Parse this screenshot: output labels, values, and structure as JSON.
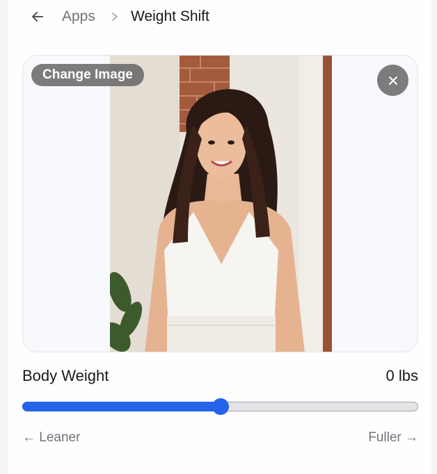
{
  "breadcrumb": {
    "back_icon": "arrow-left-icon",
    "parent": "Apps",
    "separator_icon": "chevron-right-icon",
    "current": "Weight Shift"
  },
  "image_panel": {
    "change_image_label": "Change Image",
    "close_icon": "close-icon",
    "photo_icon": "portrait-photo"
  },
  "weight": {
    "label": "Body Weight",
    "value_text": "0 lbs",
    "slider_value": 0,
    "slider_fraction": 0.5,
    "left_hint": "← Leaner",
    "right_hint": "Fuller →"
  },
  "colors": {
    "accent": "#2563eb",
    "track": "#e4e4e7",
    "muted_text": "#71717a",
    "text": "#18181b"
  }
}
